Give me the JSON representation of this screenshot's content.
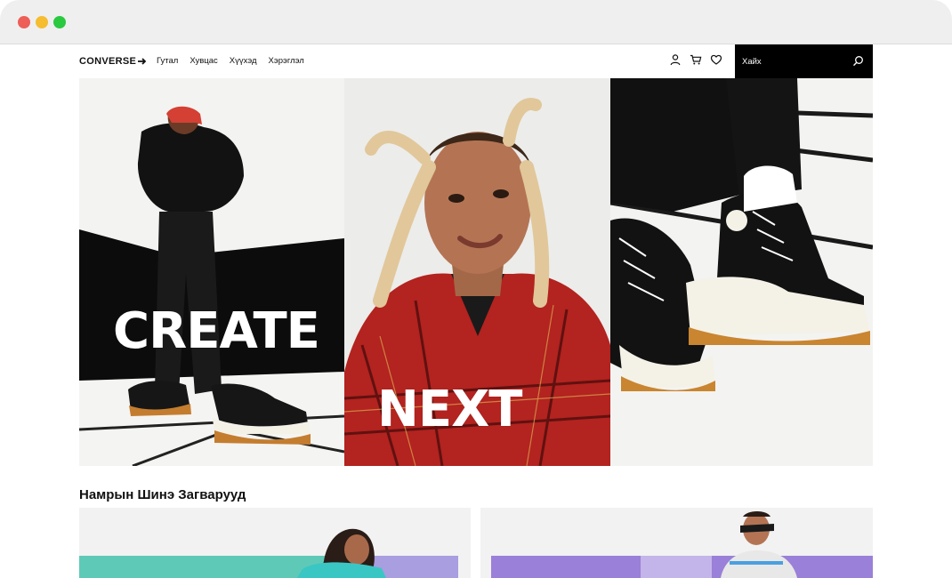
{
  "header": {
    "brand": "CONVERSE",
    "menu": [
      "Гутал",
      "Хувцас",
      "Хүүхэд",
      "Хэрэглэл"
    ],
    "search_placeholder": "Хайх"
  },
  "hero": {
    "word_1": "CREATE",
    "word_2": "NEXT"
  },
  "section": {
    "title": "Намрын Шинэ Загварууд"
  },
  "colors": {
    "nav_search_bg": "#000000",
    "card_teal": "#5fc9b8",
    "card_purple": "#9a80d8"
  }
}
